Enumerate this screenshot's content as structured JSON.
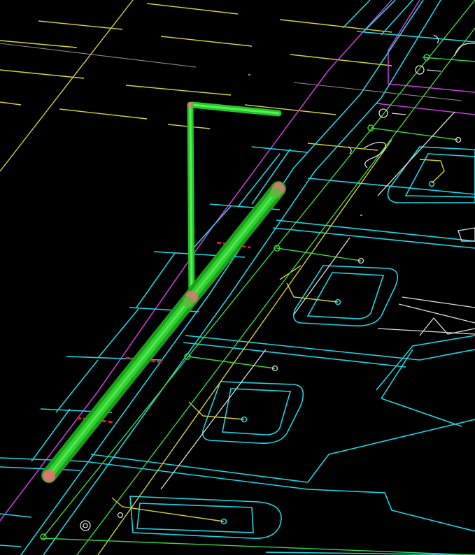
{
  "viewport": {
    "background": "#000000",
    "colors": {
      "walls": "#19d7e6",
      "annotation": "#d8d22a",
      "pipe_network": "#3ad640",
      "boundary": "#c83ad8",
      "selected_pipe": "#22c622",
      "grip_point": "#e07575",
      "cut_marker": "#e02020"
    },
    "selected_objects": [
      {
        "type": "pipe",
        "icon": "pipe-segment"
      },
      {
        "type": "pipe",
        "icon": "pipe-riser"
      },
      {
        "type": "pipe",
        "icon": "pipe-branch"
      }
    ],
    "grips": [
      "grip-point",
      "grip-point",
      "grip-point",
      "grip-point"
    ]
  }
}
